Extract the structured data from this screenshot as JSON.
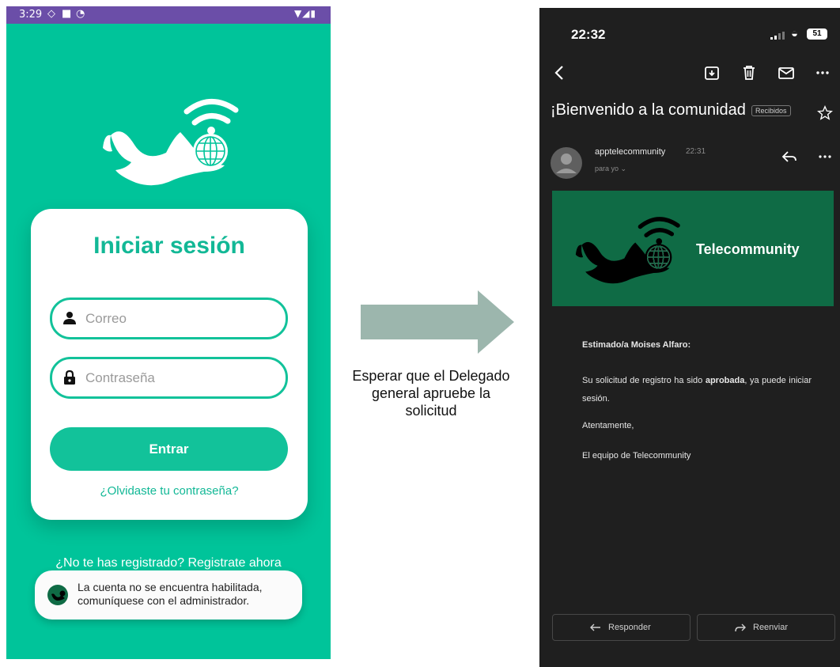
{
  "login_screen": {
    "status_bar": {
      "time": "3:29"
    },
    "title": "Iniciar sesión",
    "email_placeholder": "Correo",
    "password_placeholder": "Contraseña",
    "submit_label": "Entrar",
    "forgot_password": "¿Olvidaste tu contraseña?",
    "register_prompt": "¿No te has registrado? Registrate ahora",
    "toast_message": "La cuenta no se encuentra habilitada, comuníquese con el administrador.",
    "brand_color": "#00c49a",
    "status_bar_color": "#6b4ea8"
  },
  "arrow_caption": "Esperar que el Delegado general apruebe la solicitud",
  "email_screen": {
    "status_bar": {
      "time": "22:32",
      "battery": "51"
    },
    "subject": "¡Bienvenido a la comunidad",
    "folder_badge": "Recibidos",
    "sender": "apptelecommunity",
    "sent_time": "22:31",
    "recipient": "para yo",
    "banner_title": "Telecommunity",
    "banner_color": "#0f6b45",
    "greeting": "Estimado/a Moises Alfaro:",
    "body_before": "Su solicitud de registro ha sido ",
    "body_bold": "aprobada",
    "body_after": ", ya puede iniciar sesión.",
    "signoff": "Atentamente,",
    "signature": "El equipo de Telecommunity",
    "reply_label": "Responder",
    "forward_label": "Reenviar"
  }
}
